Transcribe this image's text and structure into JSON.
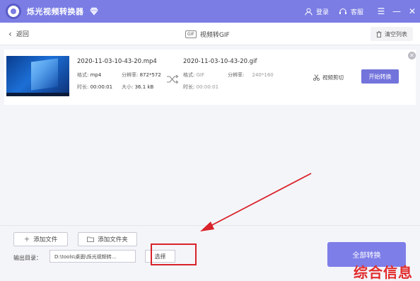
{
  "app": {
    "title": "烁光视频转换器",
    "login_label": "登录",
    "service_label": "客服",
    "menu_glyph": "☰",
    "minimize_glyph": "—",
    "close_glyph": "✕"
  },
  "navbar": {
    "back_label": "返回",
    "page_badge": "GIF",
    "page_title": "视频转GIF",
    "clear_label": "清空列表"
  },
  "file_item": {
    "source_name": "2020-11-03-10-43-20.mp4",
    "source_format_label": "格式:",
    "source_format": "mp4",
    "source_res_label": "分辨率:",
    "source_res": "872*572",
    "source_duration_label": "时长:",
    "source_duration": "00:00:01",
    "source_size_label": "大小:",
    "source_size": "36.1 kB",
    "target_name": "2020-11-03-10-43-20.gif",
    "target_format_label": "格式:",
    "target_format": "GIF",
    "target_res_label": "分辨率:",
    "target_res": "240*160",
    "target_duration_label": "时长:",
    "target_duration": "00:00:01",
    "trim_label": "视频剪切",
    "start_label": "开始转换",
    "remove_glyph": "✕"
  },
  "bottom": {
    "add_file_label": "添加文件",
    "add_folder_label": "添加文件夹",
    "output_label": "输出目录：",
    "output_path": "D:\\tools\\桌面\\烁光视频转...",
    "choose_label": "选择",
    "convert_all_label": "全部转换"
  },
  "watermark": "综合信息",
  "colors": {
    "accent": "#7b7de4",
    "button": "#7373dc",
    "annotation_red": "#d9222a"
  }
}
